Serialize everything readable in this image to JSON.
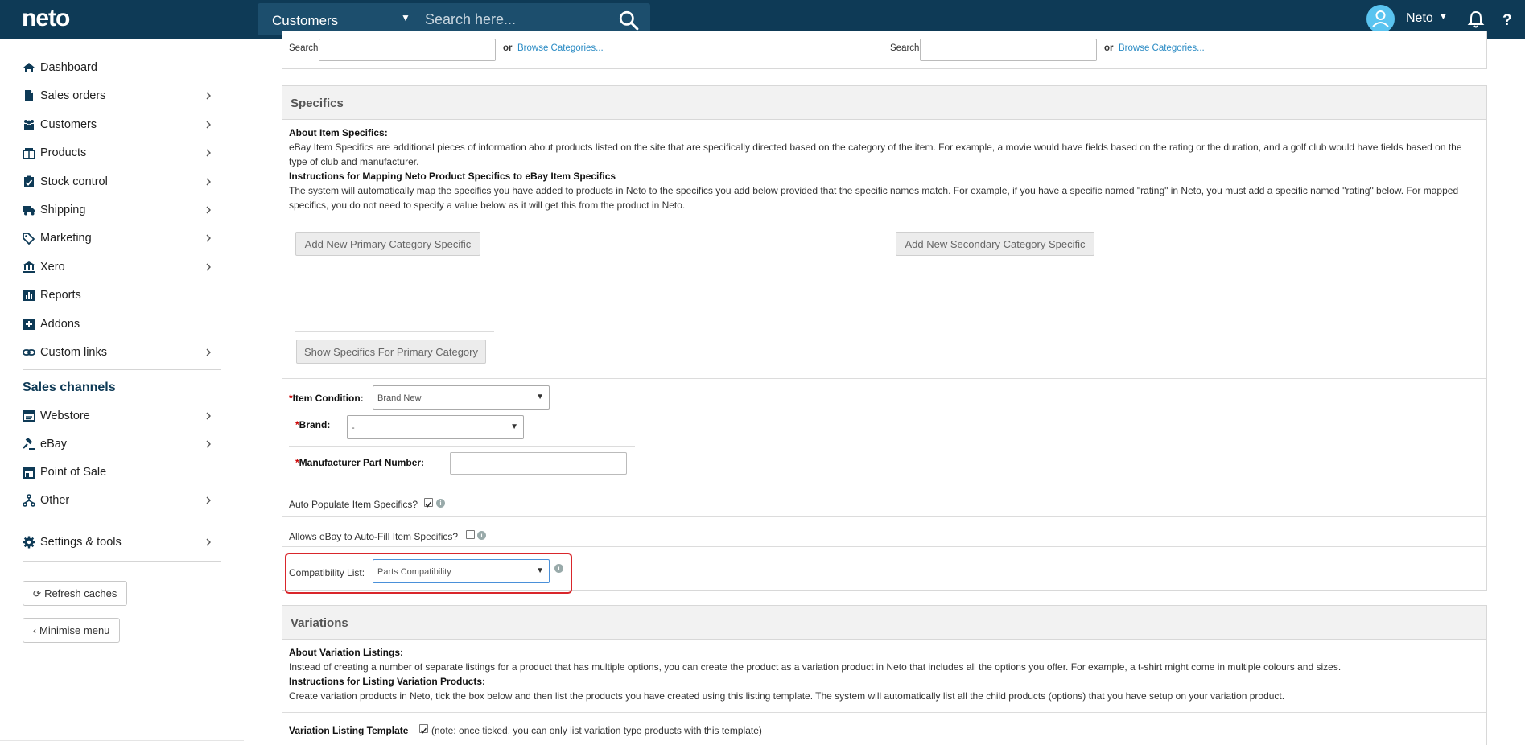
{
  "topbar": {
    "logo": "neto",
    "search_category": "Customers",
    "search_placeholder": "Search here...",
    "user_name": "Neto"
  },
  "sidebar": {
    "items": [
      {
        "label": "Dashboard",
        "icon": "home-icon",
        "chevron": false
      },
      {
        "label": "Sales orders",
        "icon": "document-icon",
        "chevron": true
      },
      {
        "label": "Customers",
        "icon": "users-icon",
        "chevron": true
      },
      {
        "label": "Products",
        "icon": "box-icon",
        "chevron": true
      },
      {
        "label": "Stock control",
        "icon": "clipboard-check-icon",
        "chevron": true
      },
      {
        "label": "Shipping",
        "icon": "truck-icon",
        "chevron": true
      },
      {
        "label": "Marketing",
        "icon": "tags-icon",
        "chevron": true
      },
      {
        "label": "Xero",
        "icon": "bank-icon",
        "chevron": true
      },
      {
        "label": "Reports",
        "icon": "chart-icon",
        "chevron": false
      },
      {
        "label": "Addons",
        "icon": "plus-square-icon",
        "chevron": false
      },
      {
        "label": "Custom links",
        "icon": "link-icon",
        "chevron": true
      }
    ],
    "sales_channels_title": "Sales channels",
    "channels": [
      {
        "label": "Webstore",
        "icon": "window-icon",
        "chevron": true
      },
      {
        "label": "eBay",
        "icon": "gavel-icon",
        "chevron": true
      },
      {
        "label": "Point of Sale",
        "icon": "store-icon",
        "chevron": false
      },
      {
        "label": "Other",
        "icon": "sitemap-icon",
        "chevron": true
      }
    ],
    "settings": {
      "label": "Settings & tools",
      "icon": "gear-icon"
    },
    "refresh_caches": "Refresh caches",
    "minimise_menu": "Minimise menu"
  },
  "category_search": {
    "search_label": "Search",
    "or_label": "or",
    "browse_link": "Browse Categories..."
  },
  "specifics": {
    "title": "Specifics",
    "about_heading": "About Item Specifics:",
    "about_text": "eBay Item Specifics are additional pieces of information about products listed on the site that are specifically directed based on the category of the item. For example, a movie would have fields based on the rating or the duration, and a golf club would have fields based on the type of club and manufacturer.",
    "instructions_heading": "Instructions for Mapping Neto Product Specifics to eBay Item Specifics",
    "instructions_text": "The system will automatically map the specifics you have added to products in Neto to the specifics you add below provided that the specific names match. For example, if you have a specific named \"rating\" in Neto, you must add a specific named \"rating\" below. For mapped specifics, you do not need to specify a value below as it will get this from the product in Neto.",
    "add_primary_btn": "Add New Primary Category Specific",
    "add_secondary_btn": "Add New Secondary Category Specific",
    "show_primary_btn": "Show Specifics For Primary Category",
    "item_condition_label": "Item Condition:",
    "item_condition_value": "Brand New",
    "brand_label": "Brand:",
    "brand_value": "-",
    "mpn_label": "Manufacturer Part Number:",
    "mpn_value": "",
    "required_mark": "*",
    "auto_populate_label": "Auto Populate Item Specifics?",
    "auto_populate_checked": true,
    "allow_autofill_label": "Allows eBay to Auto-Fill Item Specifics?",
    "allow_autofill_checked": false,
    "compat_label": "Compatibility List:",
    "compat_value": "Parts Compatibility",
    "highlight_color": "#d9262b"
  },
  "variations": {
    "title": "Variations",
    "about_heading": "About Variation Listings:",
    "about_text": "Instead of creating a number of separate listings for a product that has multiple options, you can create the product as a variation product in Neto that includes all the options you offer. For example, a t-shirt might come in multiple colours and sizes.",
    "instructions_heading": "Instructions for Listing Variation Products:",
    "instructions_text": "Create variation products in Neto, tick the box below and then list the products you have created using this listing template. The system will automatically list all the child products (options) that you have setup on your variation product.",
    "template_label": "Variation Listing Template",
    "template_checked": true,
    "template_note": "(note: once ticked, you can only list variation type products with this template)"
  },
  "colors": {
    "topbar": "#0e3a56",
    "accent_link": "#2a8bc4",
    "avatar": "#5ac4f0"
  }
}
